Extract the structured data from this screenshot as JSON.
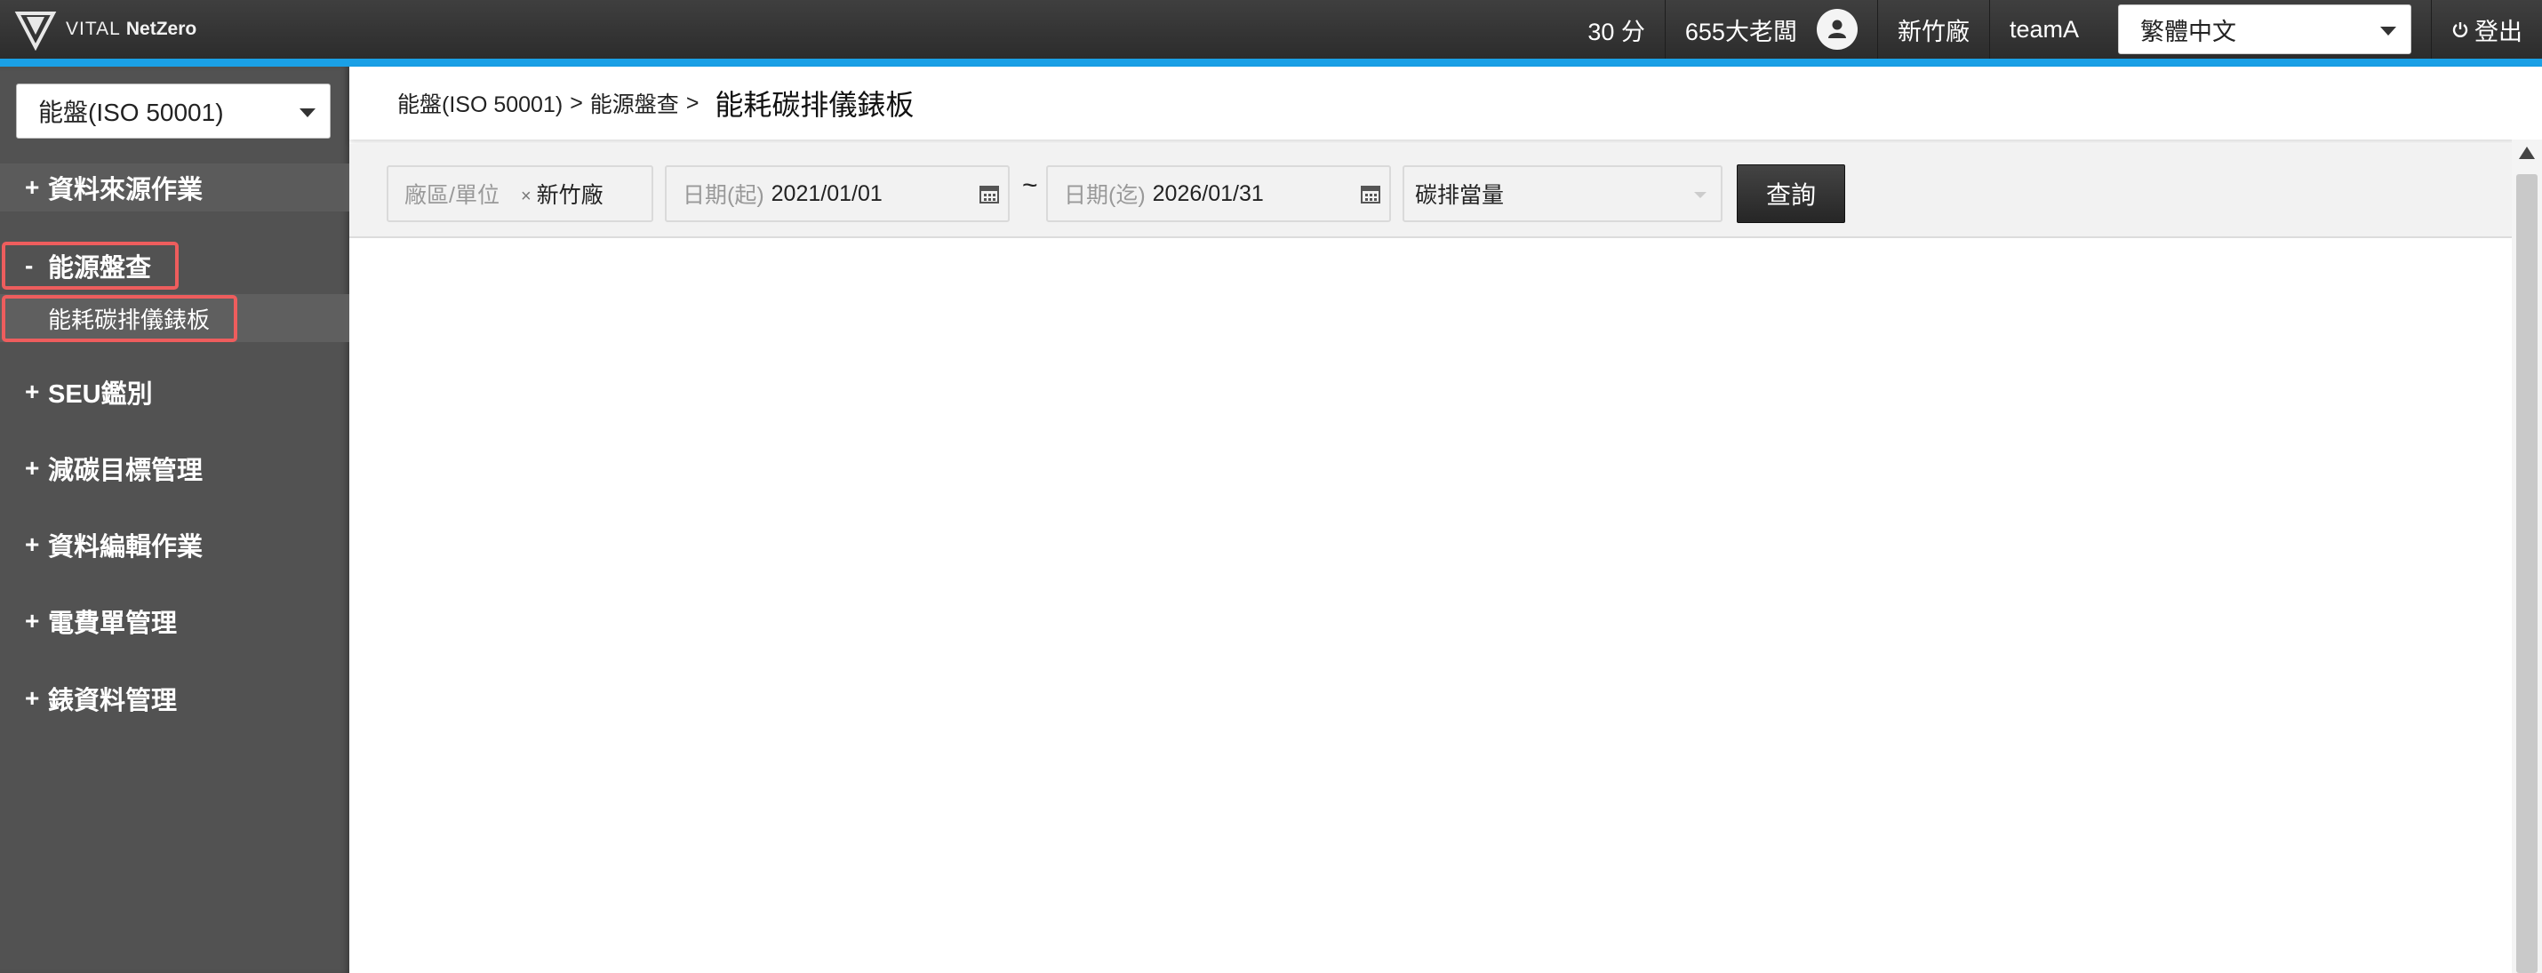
{
  "app": {
    "brand_light": "VITAL ",
    "brand_bold": "NetZero"
  },
  "topbar": {
    "points": "30 分",
    "user_name": "655大老闆",
    "factory": "新竹廠",
    "team": "teamA",
    "language": "繁體中文",
    "logout_label": "登出",
    "accent_color": "#1aa0e6"
  },
  "sidebar": {
    "module_select": "能盤(ISO 50001)",
    "items": [
      {
        "symbol": "+",
        "label": "資料來源作業"
      },
      {
        "symbol": "-",
        "label": "能源盤查"
      },
      {
        "symbol": "+",
        "label": "SEU鑑別"
      },
      {
        "symbol": "+",
        "label": "減碳目標管理"
      },
      {
        "symbol": "+",
        "label": "資料編輯作業"
      },
      {
        "symbol": "+",
        "label": "電費單管理"
      },
      {
        "symbol": "+",
        "label": "錶資料管理"
      }
    ],
    "sub_item": "能耗碳排儀錶板",
    "highlight_color": "#ee5d5d"
  },
  "breadcrumb": {
    "level1": "能盤(ISO 50001)",
    "sep": ">",
    "level2": "能源盤查",
    "current": "能耗碳排儀錶板"
  },
  "filters": {
    "site_label": "廠區/單位",
    "site_value": "新竹廠",
    "site_clear": "×",
    "start_label": "日期(起)",
    "start_value": "2021/01/01",
    "range_sep": "~",
    "end_label": "日期(迄)",
    "end_value": "2026/01/31",
    "metric_value": "碳排當量",
    "query_label": "查詢"
  }
}
